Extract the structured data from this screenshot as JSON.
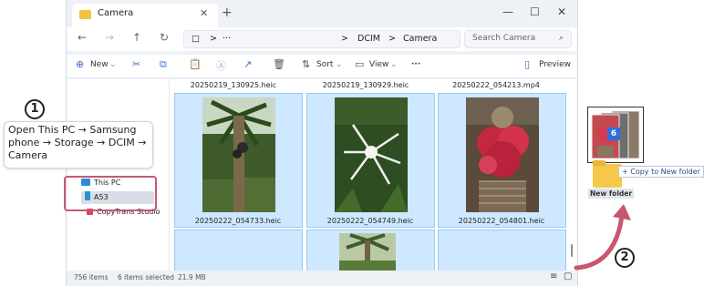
{
  "window": {
    "tab_title": "Camera",
    "tab_close": "✕",
    "tab_add": "+",
    "minimize": "—",
    "maximize": "☐",
    "close": "✕"
  },
  "address": {
    "back": "←",
    "forward": "→",
    "up": "↑",
    "refresh": "↻",
    "device_icon": "□",
    "sep1": ">",
    "ellipsis": "···",
    "sep2": ">",
    "crumb1": "DCIM",
    "sep3": ">",
    "crumb2": "Camera",
    "search_placeholder": "Search Camera",
    "search_icon": "⌕"
  },
  "commands": {
    "new_label": "New",
    "new_icon": "⊕",
    "cut_icon": "✂",
    "copy_icon": "⧉",
    "paste_icon": "📋",
    "rename_icon": "Ⓐ",
    "share_icon": "↗",
    "delete_icon": "🗑",
    "sort_label": "Sort",
    "sort_icon": "⇅",
    "view_label": "View",
    "view_icon": "▭",
    "more": "···",
    "preview_label": "Preview",
    "preview_icon": "▯",
    "dropdown": "⌄"
  },
  "navpane": {
    "items": [
      {
        "label": "This PC",
        "color": "#2e8ad8"
      },
      {
        "label": "A53",
        "color": "#2b8fd6"
      },
      {
        "label": "CopyTrans Studio",
        "color": "#e0415a"
      }
    ]
  },
  "files": {
    "top_row": [
      "20250219_130925.heic",
      "20250219_130929.heic",
      "20250222_054213.mp4"
    ],
    "cards": [
      "20250222_054733.heic",
      "20250222_054749.heic",
      "20250222_054801.heic"
    ]
  },
  "status": {
    "count": "756 items",
    "selected": "6 items selected",
    "size": "21.9 MB",
    "details_icon": "≡",
    "tiles_icon": "▢"
  },
  "annotations": {
    "step1": "1",
    "step1_text": "Open This PC → Samsung phone → Storage → DCIM → Camera",
    "step2": "2",
    "highlight_color": "#c9566f"
  },
  "drag": {
    "badge": "6",
    "copy_tip": "+ Copy to New folder",
    "target_label": "New folder"
  }
}
